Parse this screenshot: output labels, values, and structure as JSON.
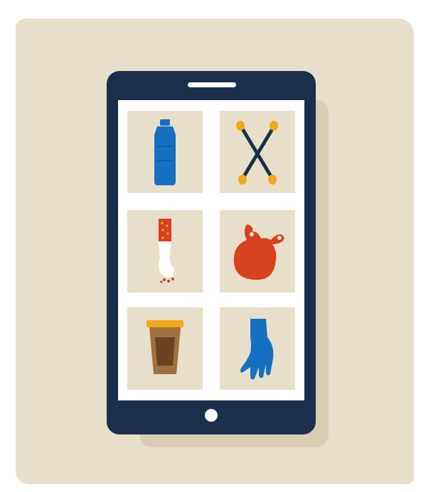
{
  "colors": {
    "card": "#e8dfcb",
    "phone_frame": "#1a2f4b",
    "screen": "#ffffff",
    "tile": "#e8dfcb",
    "accent_blue": "#1670c2",
    "accent_orange": "#d6411e",
    "accent_yellow": "#f2a81b"
  },
  "phone": {
    "controls": [
      "speaker",
      "home-button"
    ]
  },
  "tiles": [
    {
      "item": "plastic-bottle",
      "icon": "bottle-icon"
    },
    {
      "item": "cotton-buds",
      "icon": "cotton-buds-icon"
    },
    {
      "item": "cigarette-butt",
      "icon": "cigarette-icon"
    },
    {
      "item": "plastic-bag",
      "icon": "plastic-bag-icon"
    },
    {
      "item": "coffee-cup",
      "icon": "coffee-cup-icon"
    },
    {
      "item": "rubber-glove",
      "icon": "glove-icon"
    }
  ]
}
